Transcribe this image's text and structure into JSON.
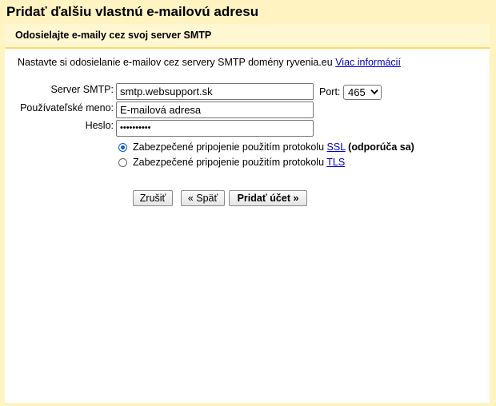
{
  "dialog": {
    "title": "Pridať ďalšiu vlastnú e-mailovú adresu",
    "subheading": "Odosielajte e-maily cez svoj server SMTP",
    "intro_text": "Nastavte si odosielanie e-mailov cez servery SMTP domény ryvenia.eu",
    "intro_link": "Viac informácií"
  },
  "form": {
    "smtp_label": "Server SMTP:",
    "smtp_value": "smtp.websupport.sk",
    "port_label": "Port:",
    "port_value": "465",
    "username_label": "Používateľské meno:",
    "username_value": "E-mailová adresa",
    "password_label": "Heslo:",
    "password_value": "••••••••••",
    "ssl_option": {
      "text": "Zabezpečené pripojenie použitím protokolu ",
      "link": "SSL",
      "note": "(odporúča sa)",
      "selected": true
    },
    "tls_option": {
      "text": "Zabezpečené pripojenie použitím protokolu ",
      "link": "TLS",
      "selected": false
    }
  },
  "buttons": {
    "cancel": "Zrušiť",
    "back": "« Späť",
    "add": "Pridať účet »"
  },
  "colors": {
    "background": "#fff3c2",
    "divider": "#ffd866",
    "link": "#0000cc",
    "radio_selected": "#0a5cd6"
  }
}
